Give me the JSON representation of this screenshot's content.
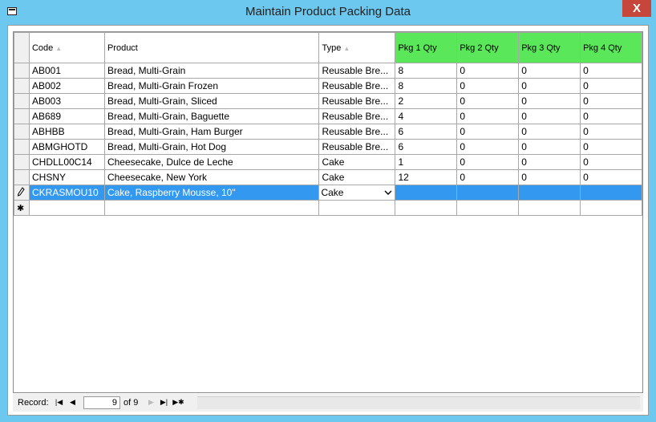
{
  "window": {
    "title": "Maintain Product Packing Data",
    "close_label": "X"
  },
  "columns": {
    "code": "Code",
    "product": "Product",
    "type": "Type",
    "pkg1": "Pkg 1 Qty",
    "pkg2": "Pkg 2 Qty",
    "pkg3": "Pkg 3 Qty",
    "pkg4": "Pkg 4 Qty"
  },
  "rows": [
    {
      "code": "AB001",
      "product": "Bread, Multi-Grain",
      "type": "Reusable Bre...",
      "pkg1": "8",
      "pkg2": "0",
      "pkg3": "0",
      "pkg4": "0"
    },
    {
      "code": "AB002",
      "product": "Bread, Multi-Grain Frozen",
      "type": "Reusable Bre...",
      "pkg1": "8",
      "pkg2": "0",
      "pkg3": "0",
      "pkg4": "0"
    },
    {
      "code": "AB003",
      "product": "Bread, Multi-Grain, Sliced",
      "type": "Reusable Bre...",
      "pkg1": "2",
      "pkg2": "0",
      "pkg3": "0",
      "pkg4": "0"
    },
    {
      "code": "AB689",
      "product": "Bread, Multi-Grain, Baguette",
      "type": "Reusable Bre...",
      "pkg1": "4",
      "pkg2": "0",
      "pkg3": "0",
      "pkg4": "0"
    },
    {
      "code": "ABHBB",
      "product": "Bread, Multi-Grain, Ham Burger",
      "type": "Reusable Bre...",
      "pkg1": "6",
      "pkg2": "0",
      "pkg3": "0",
      "pkg4": "0"
    },
    {
      "code": "ABMGHOTD",
      "product": "Bread, Multi-Grain, Hot Dog",
      "type": "Reusable Bre...",
      "pkg1": "6",
      "pkg2": "0",
      "pkg3": "0",
      "pkg4": "0"
    },
    {
      "code": "CHDLL00C14",
      "product": "Cheesecake, Dulce de Leche",
      "type": "Cake",
      "pkg1": "1",
      "pkg2": "0",
      "pkg3": "0",
      "pkg4": "0"
    },
    {
      "code": "CHSNY",
      "product": "Cheesecake, New York",
      "type": "Cake",
      "pkg1": "12",
      "pkg2": "0",
      "pkg3": "0",
      "pkg4": "0"
    }
  ],
  "current_row": {
    "code": "CKRASMOU10",
    "product": "Cake, Raspberry Mousse, 10\"",
    "type": "Cake",
    "pkg1": "",
    "pkg2": "",
    "pkg3": "",
    "pkg4": ""
  },
  "new_row_marker": "✱",
  "record_nav": {
    "label": "Record:",
    "current": "9",
    "of_text": "of 9"
  },
  "colors": {
    "title_bar": "#6dc8ef",
    "close": "#c7463c",
    "header_green": "#5ae85a",
    "selection": "#3399f0"
  }
}
